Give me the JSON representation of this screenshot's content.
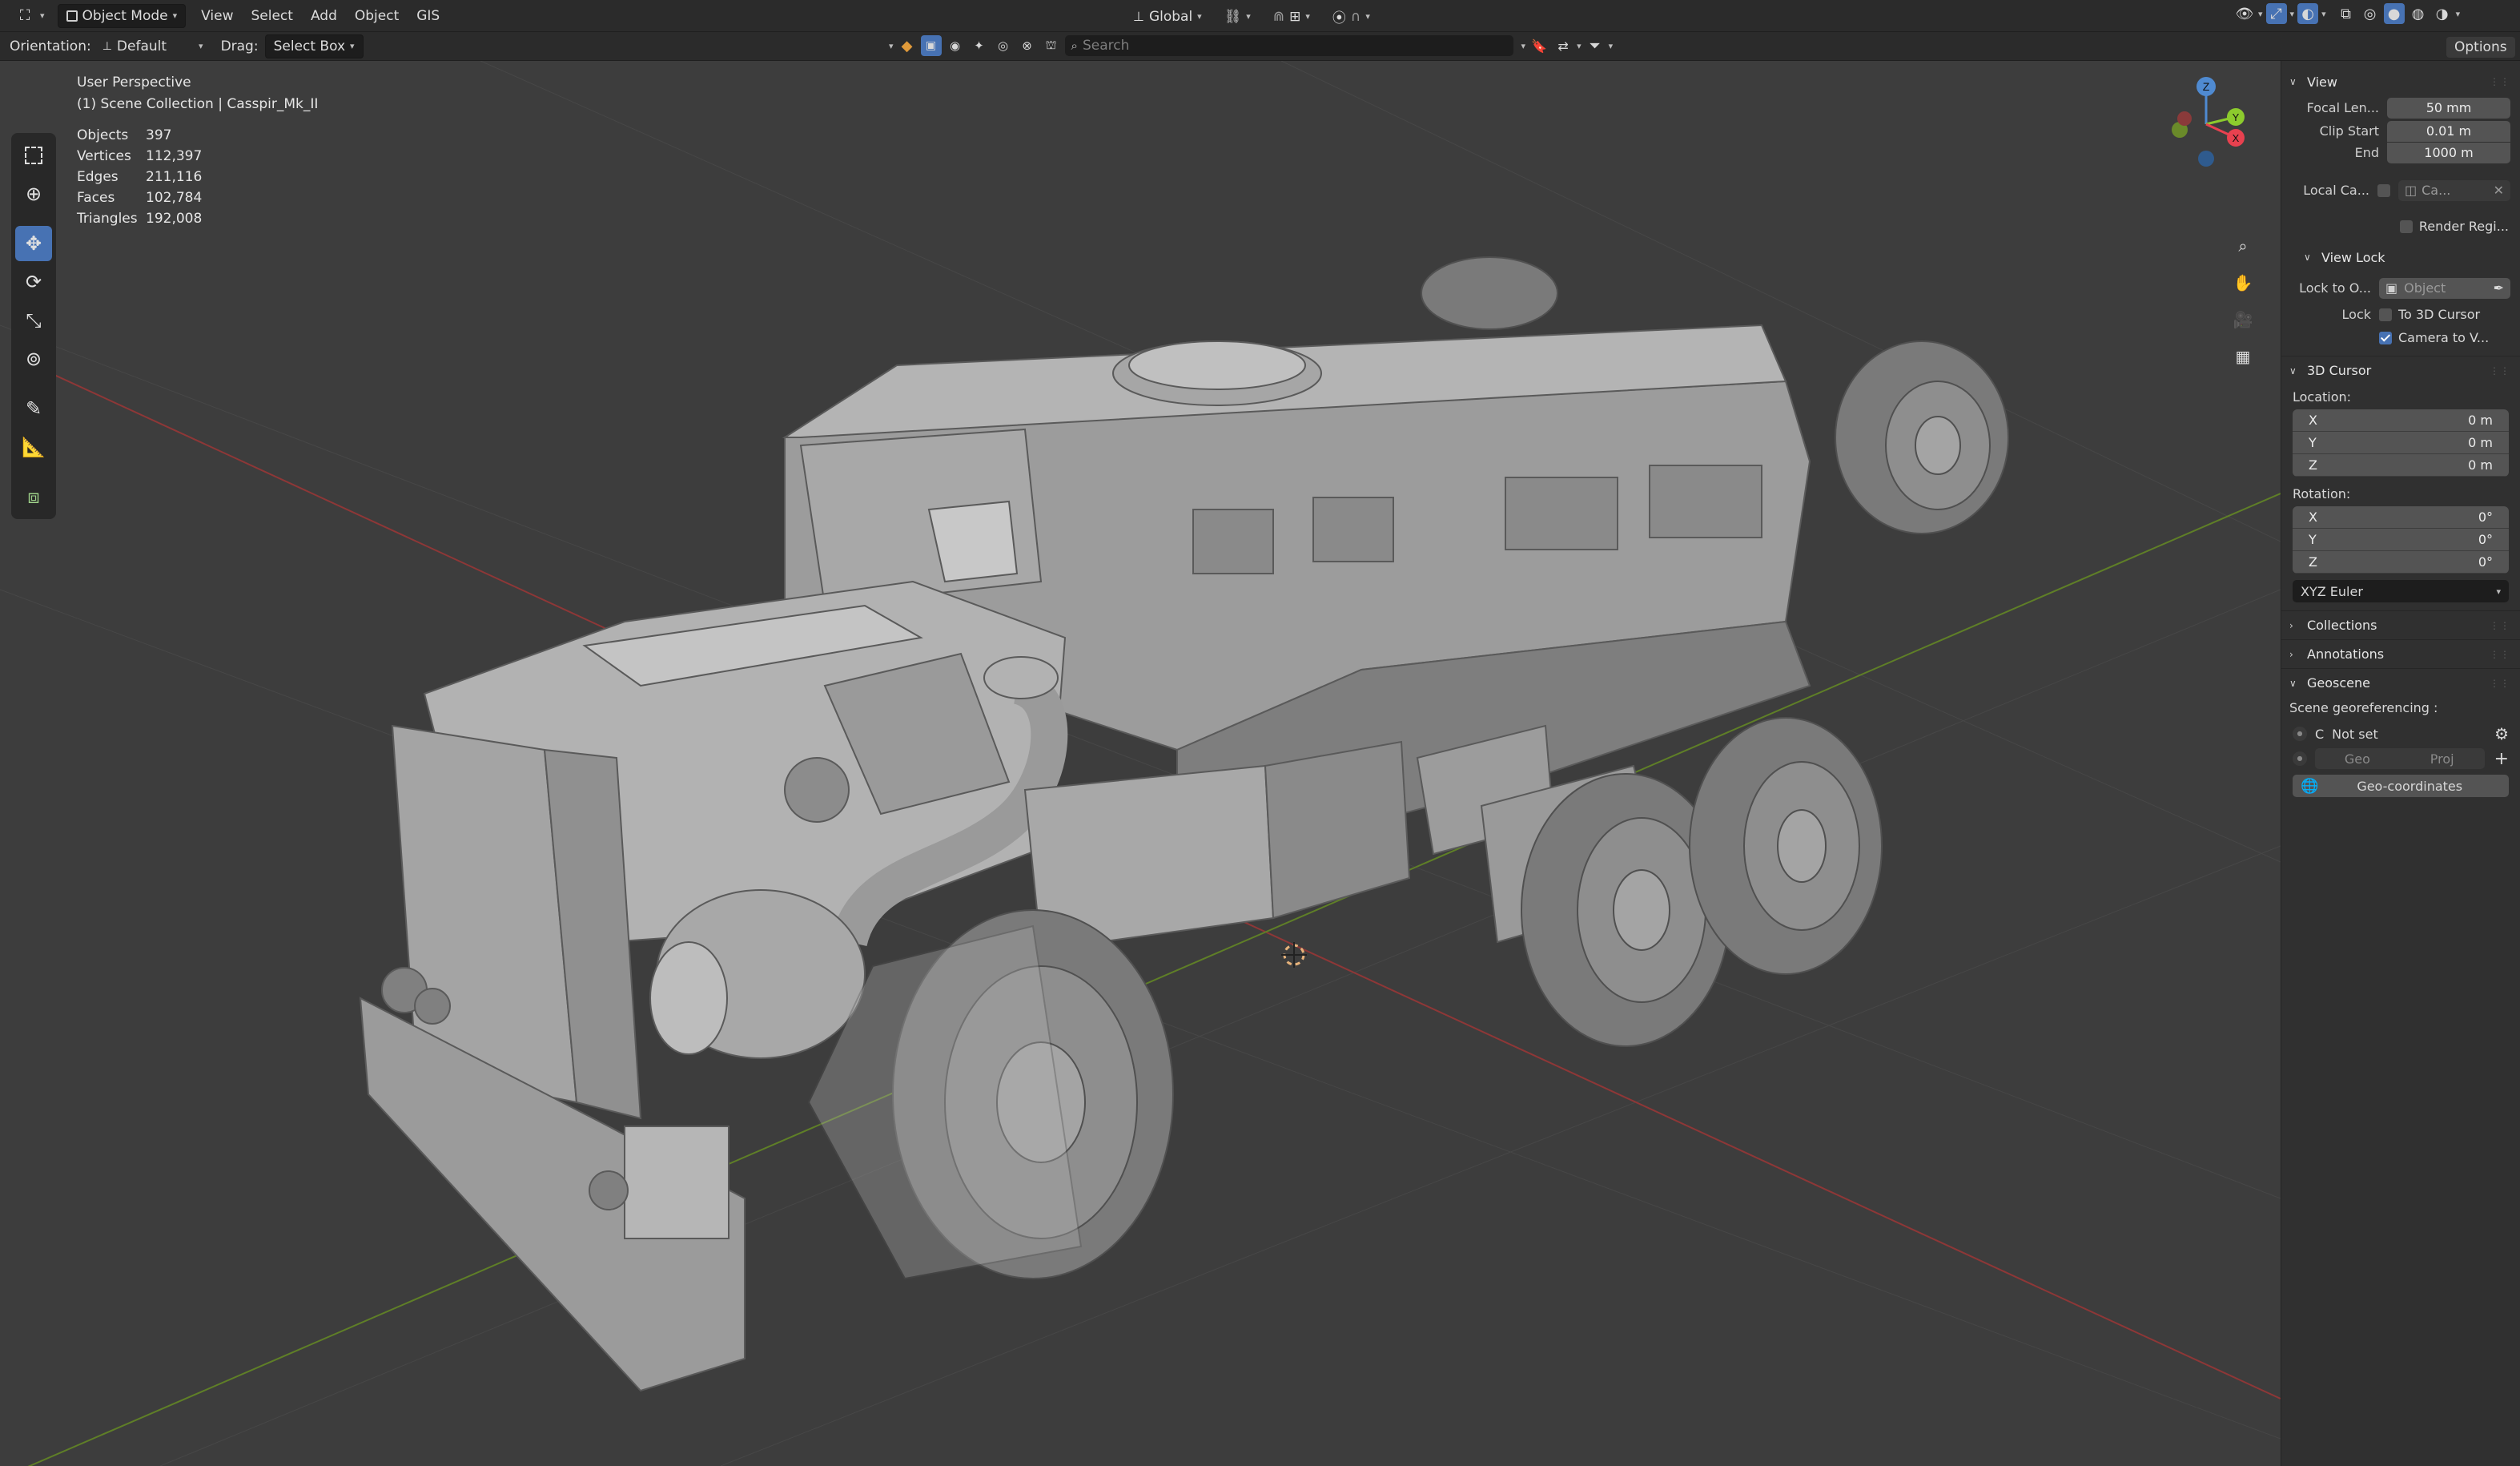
{
  "topbar": {
    "mode": "Object Mode",
    "menus": [
      "View",
      "Select",
      "Add",
      "Object",
      "GIS"
    ],
    "transform_orientation": "Global"
  },
  "header2": {
    "orientation_label": "Orientation:",
    "orientation_value": "Default",
    "drag_label": "Drag:",
    "drag_value": "Select Box",
    "search_placeholder": "Search",
    "options_label": "Options"
  },
  "viewport": {
    "perspective": "User Perspective",
    "collection": "(1) Scene Collection | Casspir_Mk_II",
    "stats": [
      {
        "label": "Objects",
        "value": "397"
      },
      {
        "label": "Vertices",
        "value": "112,397"
      },
      {
        "label": "Edges",
        "value": "211,116"
      },
      {
        "label": "Faces",
        "value": "102,784"
      },
      {
        "label": "Triangles",
        "value": "192,008"
      }
    ],
    "gizmo": {
      "z": "Z",
      "y": "Y",
      "x": "X"
    }
  },
  "npanel": {
    "view": {
      "title": "View",
      "focal_label": "Focal Len...",
      "focal_value": "50 mm",
      "clip_start_label": "Clip Start",
      "clip_start_value": "0.01 m",
      "end_label": "End",
      "end_value": "1000 m",
      "local_camera_label": "Local Ca...",
      "local_camera_value": "Ca...",
      "render_region_label": "Render Regi..."
    },
    "view_lock": {
      "title": "View Lock",
      "lock_to_object_label": "Lock to O...",
      "lock_to_object_placeholder": "Object",
      "lock_label": "Lock",
      "to_3d_cursor": "To 3D Cursor",
      "camera_to_view": "Camera to V..."
    },
    "cursor": {
      "title": "3D Cursor",
      "location_label": "Location:",
      "location": [
        {
          "axis": "X",
          "value": "0 m"
        },
        {
          "axis": "Y",
          "value": "0 m"
        },
        {
          "axis": "Z",
          "value": "0 m"
        }
      ],
      "rotation_label": "Rotation:",
      "rotation": [
        {
          "axis": "X",
          "value": "0°"
        },
        {
          "axis": "Y",
          "value": "0°"
        },
        {
          "axis": "Z",
          "value": "0°"
        }
      ],
      "rotation_mode": "XYZ Euler"
    },
    "collections": "Collections",
    "annotations": "Annotations",
    "geoscene": {
      "title": "Geoscene",
      "georef_label": "Scene georeferencing :",
      "crs_letter": "C",
      "crs_value": "Not set",
      "geo_btn": "Geo",
      "proj_btn": "Proj",
      "geocoords_btn": "Geo-coordinates"
    }
  },
  "colors": {
    "accent": "#4772b3",
    "header_bg": "#2b2b2b",
    "viewport_bg": "#3d3d3d",
    "axis_x": "#a33a3a",
    "axis_y": "#6b8f2a"
  }
}
